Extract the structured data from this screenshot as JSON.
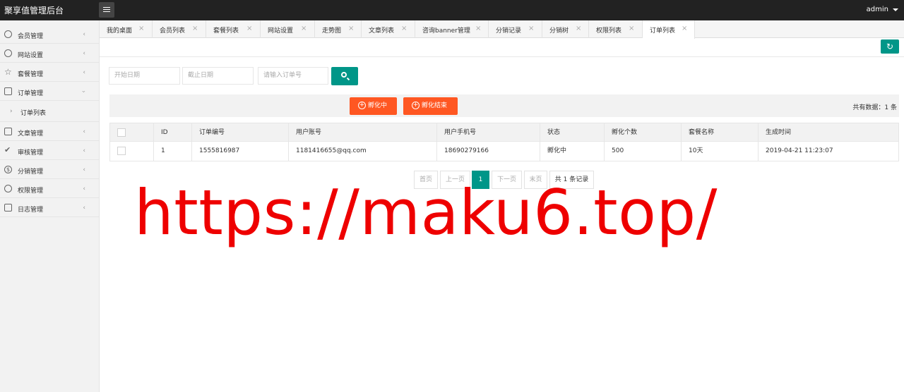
{
  "app": {
    "title": "聚享值管理后台",
    "user": "admin"
  },
  "sidebar": {
    "items": [
      {
        "label": "会员管理",
        "icon": "user-icon"
      },
      {
        "label": "网站设置",
        "icon": "gear-icon"
      },
      {
        "label": "套餐管理",
        "icon": "star-icon"
      },
      {
        "label": "订单管理",
        "icon": "grid-icon",
        "expanded": true
      },
      {
        "label": "文章管理",
        "icon": "book-icon"
      },
      {
        "label": "审核管理",
        "icon": "check-icon"
      },
      {
        "label": "分销管理",
        "icon": "dollar-icon"
      },
      {
        "label": "权限管理",
        "icon": "link-icon"
      },
      {
        "label": "日志管理",
        "icon": "edit-icon"
      }
    ],
    "sub_items": [
      {
        "label": "订单列表"
      }
    ]
  },
  "tabs": [
    {
      "label": "我的桌面"
    },
    {
      "label": "会员列表"
    },
    {
      "label": "套餐列表"
    },
    {
      "label": "网站设置"
    },
    {
      "label": "走势图"
    },
    {
      "label": "文章列表"
    },
    {
      "label": "咨询banner管理"
    },
    {
      "label": "分销记录"
    },
    {
      "label": "分销树"
    },
    {
      "label": "权限列表"
    },
    {
      "label": "订单列表",
      "active": true
    }
  ],
  "search": {
    "start_placeholder": "开始日期",
    "end_placeholder": "截止日期",
    "order_placeholder": "请输入订单号"
  },
  "actions": {
    "hatching_label": "孵化中",
    "hatched_label": "孵化结束",
    "total_text": "共有数据：1 条"
  },
  "table": {
    "columns": [
      "",
      "ID",
      "订单编号",
      "用户账号",
      "用户手机号",
      "状态",
      "孵化个数",
      "套餐名称",
      "生成时间"
    ],
    "rows": [
      [
        "",
        "1",
        "1555816987",
        "1181416655@qq.com",
        "18690279166",
        "孵化中",
        "500",
        "10天",
        "2019-04-21 11:23:07"
      ]
    ]
  },
  "pager": {
    "first": "首页",
    "prev": "上一页",
    "current": "1",
    "next": "下一页",
    "last": "末页",
    "info": "共 1 条记录"
  },
  "watermark": "https://maku6.top/",
  "colors": {
    "primary": "#009688",
    "warning": "#ff5722",
    "topbar": "#222222",
    "watermark": "#ee0000"
  }
}
